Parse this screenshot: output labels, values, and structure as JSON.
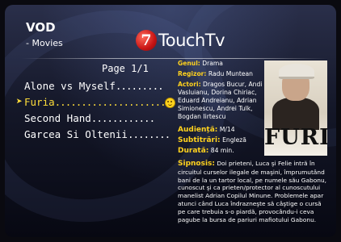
{
  "header": {
    "section": "VOD",
    "subsection": "- Movies",
    "brand_letter": "7",
    "brand_name": "TouchTv"
  },
  "list": {
    "page_label": "Page 1/1",
    "items": [
      {
        "title": "Alone vs Myself",
        "dots": ".........",
        "selected": false
      },
      {
        "title": "Furia",
        "dots": "......................",
        "selected": true
      },
      {
        "title": "Second Hand",
        "dots": "............",
        "selected": false
      },
      {
        "title": "Garcea Si Oltenii",
        "dots": "........",
        "selected": false
      }
    ]
  },
  "details": {
    "genre_label": "Genul:",
    "genre": "Drama",
    "director_label": "Regizor:",
    "director": "Radu Muntean",
    "actors_label": "Actori:",
    "actors": "Dragos Bucur, Andi Vasluianu, Dorina Chiriac, Eduard Andreianu, Adrian Simionescu, Andrei Tulk, Bogdan Iirtescu",
    "audience_label": "Audiență:",
    "audience": "M/14",
    "subtitles_label": "Subtitrări:",
    "subtitles": "Engleză",
    "duration_label": "Durată:",
    "duration": "84 min.",
    "synopsis_label": "Sipnosis:",
    "synopsis": "Doi prieteni, Luca şi Felie intră în circuitul curselor ilegale de maşini, împrumutând bani de la un tartor local, pe numele său Gabonu, cunoscut şi ca prieten/protector al cunoscutului manelist Adrian Copilul Minune. Problemele apar atunci când Luca îndrazneşte să câştige o cursă pe care trebuia s-o piardă, provocându-i ceva pagube la bursa de pariuri mafiotului Gabonu."
  },
  "poster": {
    "title": "FURIA"
  },
  "colors": {
    "highlight": "#ffde3a",
    "label": "#ffd21e",
    "logo": "#c81414"
  },
  "icons": {
    "selector": "selection-arrow-icon",
    "status": "smiley-icon"
  }
}
